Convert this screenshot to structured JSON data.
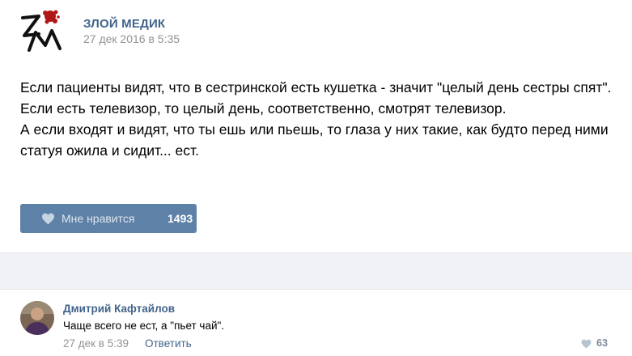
{
  "post": {
    "author": "ЗЛОЙ МЕДИК",
    "date": "27 дек 2016 в 5:35",
    "text_lines": [
      "Если пациенты видят, что в сестринской есть кушетка - значит \"целый день сестры спят\".",
      "Если есть телевизор, то целый день, соответственно, смотрят телевизор.",
      "А если входят и видят, что ты ешь или пьешь, то глаза у них такие, как будто перед ними статуя ожила и сидит... ест."
    ],
    "like_label": "Мне нравится",
    "like_count": "1493",
    "icons": {
      "avatar": "zm-logo-icon",
      "like": "heart-icon"
    }
  },
  "comment": {
    "author": "Дмитрий Кафтайлов",
    "text": "Чаще всего не ест, а \"пьет чай\".",
    "date": "27 дек в 5:39",
    "reply_label": "Ответить",
    "like_count": "63",
    "icons": {
      "avatar": "user-avatar",
      "like": "heart-icon"
    }
  },
  "colors": {
    "link": "#42648b",
    "muted": "#939393",
    "like_button": "#5e81a8",
    "divider_bg": "#f0f2f5"
  }
}
